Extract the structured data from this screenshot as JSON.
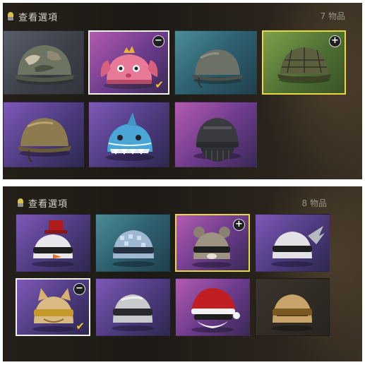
{
  "panels": [
    {
      "title": "查看選項",
      "count": "7 物品",
      "items": [
        {
          "name": "camo-helmet",
          "rarity": "grey",
          "state": "normal"
        },
        {
          "name": "pink-bunny-helmet",
          "rarity": "pink",
          "state": "selected",
          "badge": "−",
          "check": "✔"
        },
        {
          "name": "steel-helmet",
          "rarity": "blue",
          "state": "normal"
        },
        {
          "name": "netted-helmet",
          "rarity": "green",
          "state": "highlight",
          "badge": "+"
        },
        {
          "name": "gold-helmet",
          "rarity": "purple",
          "state": "normal"
        },
        {
          "name": "shark-helmet",
          "rarity": "purple",
          "state": "normal"
        },
        {
          "name": "tactical-helmet",
          "rarity": "pink",
          "state": "normal"
        }
      ]
    },
    {
      "title": "查看選項",
      "count": "8 物品",
      "items": [
        {
          "name": "snowman-top-hat-helmet",
          "rarity": "purple",
          "state": "normal"
        },
        {
          "name": "disco-helmet",
          "rarity": "blue",
          "state": "normal"
        },
        {
          "name": "bear-ear-helmet",
          "rarity": "pink",
          "state": "highlight",
          "badge": "+"
        },
        {
          "name": "winged-helmet",
          "rarity": "purple",
          "state": "normal"
        },
        {
          "name": "cat-ear-gold-helmet",
          "rarity": "purple",
          "state": "selected",
          "badge": "−",
          "check": "✔"
        },
        {
          "name": "silver-helmet",
          "rarity": "purple",
          "state": "normal"
        },
        {
          "name": "santa-helmet",
          "rarity": "pink",
          "state": "normal"
        },
        {
          "name": "tan-helmet",
          "rarity": "dark",
          "state": "normal"
        }
      ]
    }
  ],
  "colors": {
    "highlight_border": "#e8d940",
    "selected_border": "#f0f0ec",
    "check": "#f0c82c"
  }
}
